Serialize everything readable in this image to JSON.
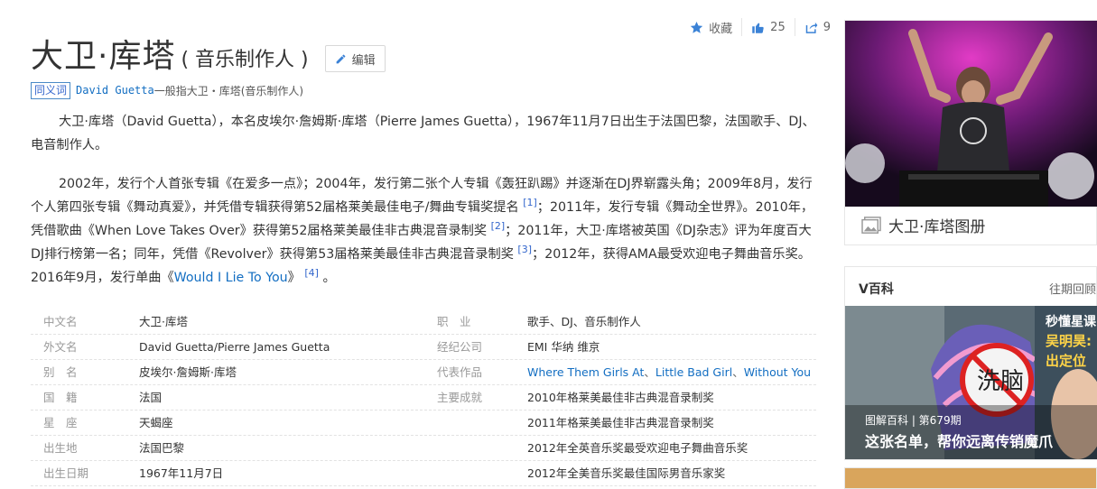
{
  "actions": {
    "favorite_label": "收藏",
    "like_count": "25",
    "share_count": "9"
  },
  "title": {
    "main": "大卫·库塔",
    "subtitle": "( 音乐制作人 )",
    "edit_label": "编辑"
  },
  "synonym": {
    "badge": "同义词",
    "link": "David Guetta",
    "text": "一般指大卫・库塔(音乐制作人)"
  },
  "paragraphs": {
    "p1": "大卫·库塔（David Guetta），本名皮埃尔·詹姆斯·库塔（Pierre James Guetta），1967年11月7日出生于法国巴黎，法国歌手、DJ、电音制作人。",
    "p2_a": "2002年，发行个人首张专辑《在爱多一点》；2004年，发行第二张个人专辑《轰狂趴踢》并逐渐在DJ界崭露头角；2009年8月，发行个人第四张专辑《舞动真爱》，并凭借专辑获得第52届格莱美最佳电子/舞曲专辑奖提名",
    "ref1": "[1]",
    "p2_b": "；2011年，发行专辑《舞动全世界》。2010年，凭借歌曲《When Love Takes Over》获得第52届格莱美最佳非古典混音录制奖",
    "ref2": "[2]",
    "p2_c": "；2011年，大卫·库塔被英国《DJ杂志》评为年度百大DJ排行榜第一名；同年，凭借《Revolver》获得第53届格莱美最佳非古典混音录制奖",
    "ref3": "[3]",
    "p2_d": "；2012年，获得AMA最受欢迎电子舞曲音乐奖。2016年9月，发行单曲《",
    "p2_link": "Would I Lie To You",
    "p2_e": "》",
    "ref4": "[4]",
    "p2_f": "。"
  },
  "info": {
    "rows": [
      {
        "k1": "中文名",
        "v1": "大卫·库塔",
        "k2": "职　业",
        "v2": "歌手、DJ、音乐制作人"
      },
      {
        "k1": "外文名",
        "v1": "David Guetta/Pierre James Guetta",
        "k2": "经纪公司",
        "v2": "EMI 华纳 维京"
      },
      {
        "k1": "别　名",
        "v1": "皮埃尔·詹姆斯·库塔",
        "k2": "代表作品",
        "v2_links": [
          "Where Them Girls At",
          "Little Bad Girl",
          "Without You"
        ],
        "v2_sep": "、"
      },
      {
        "k1": "国　籍",
        "v1": "法国",
        "k2": "主要成就",
        "v2": "2010年格莱美最佳非古典混音录制奖"
      },
      {
        "k1": "星　座",
        "v1": "天蝎座",
        "k2": "",
        "v2": "2011年格莱美最佳非古典混音录制奖"
      },
      {
        "k1": "出生地",
        "v1": "法国巴黎",
        "k2": "",
        "v2": "2012年全英音乐奖最受欢迎电子舞曲音乐奖"
      },
      {
        "k1": "出生日期",
        "v1": "1967年11月7日",
        "k2": "",
        "v2": "2012年全美音乐奖最佳国际男音乐家奖"
      }
    ]
  },
  "sidebar": {
    "album_caption": "大卫·库塔图册",
    "v_title": "V百科",
    "v_more": "往期回顾",
    "v_tag": "图解百科 | 第679期",
    "v_headline": "这张名单，帮你远离传销魔爪",
    "v_side_1": "秒懂星课",
    "v_side_2": "吴明昊:",
    "v_side_3": "出定位",
    "v_hat_text": "洗脑"
  },
  "colors": {
    "link": "#136ec2",
    "accent_blue": "#3366cc",
    "muted": "#999999"
  }
}
